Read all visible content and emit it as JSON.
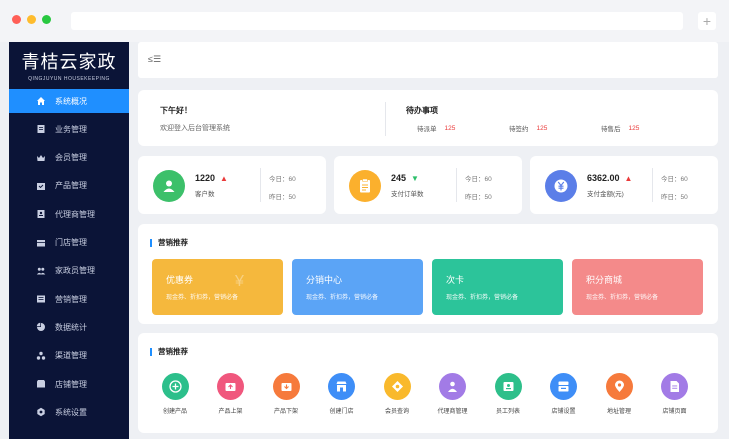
{
  "brand": {
    "name_cn": "青桔云家政",
    "name_en": "QINGJUYUN HOUSEKEEPING"
  },
  "sidebar": {
    "items": [
      {
        "label": "系统概况",
        "icon": "home-icon",
        "active": true
      },
      {
        "label": "业务管理",
        "icon": "document-icon"
      },
      {
        "label": "会员管理",
        "icon": "crown-icon"
      },
      {
        "label": "产品管理",
        "icon": "product-icon"
      },
      {
        "label": "代理商管理",
        "icon": "agent-icon"
      },
      {
        "label": "门店管理",
        "icon": "store-icon"
      },
      {
        "label": "家政员管理",
        "icon": "people-icon"
      },
      {
        "label": "营销管理",
        "icon": "marketing-icon"
      },
      {
        "label": "数据统计",
        "icon": "pie-chart-icon"
      },
      {
        "label": "渠道管理",
        "icon": "channel-icon"
      },
      {
        "label": "店铺管理",
        "icon": "shop-icon"
      },
      {
        "label": "系统设置",
        "icon": "settings-icon"
      }
    ]
  },
  "topbar": {
    "collapse_icon": "≤☰"
  },
  "welcome": {
    "greeting": "下午好！",
    "message": "欢迎登入后台管理系统"
  },
  "todo": {
    "title": "待办事项",
    "items": [
      {
        "label": "待派单",
        "count": "125",
        "icon": "dispatch-icon"
      },
      {
        "label": "待签约",
        "count": "125",
        "icon": "sign-icon"
      },
      {
        "label": "待售后",
        "count": "125",
        "icon": "aftersale-icon"
      }
    ]
  },
  "stats": [
    {
      "value": "1220",
      "trend": "up",
      "trend_glyph": "▲",
      "label": "客户数",
      "today": "今日：60",
      "yesterday": "昨日：50",
      "color": "#3cc06a",
      "icon": "user-icon"
    },
    {
      "value": "245",
      "trend": "down",
      "trend_glyph": "▼",
      "label": "支付订单数",
      "today": "今日：60",
      "yesterday": "昨日：50",
      "color": "#fbb02d",
      "icon": "clipboard-icon"
    },
    {
      "value": "6362.00",
      "trend": "up",
      "trend_glyph": "▲",
      "label": "支付金额(元)",
      "today": "今日：60",
      "yesterday": "昨日：50",
      "color": "#5b7ee8",
      "icon": "yuan-icon"
    }
  ],
  "marketing": {
    "title": "营销推荐",
    "cards": [
      {
        "title": "优惠券",
        "subtitle": "现金券、折扣券，营销必备",
        "color": "#f5b83d",
        "icon": "coupon-icon"
      },
      {
        "title": "分销中心",
        "subtitle": "现金券、折扣券，营销必备",
        "color": "#5ba4f6",
        "icon": "blocks-icon"
      },
      {
        "title": "次卡",
        "subtitle": "现金券、折扣券，营销必备",
        "color": "#2cc49a",
        "icon": "card-icon"
      },
      {
        "title": "积分商城",
        "subtitle": "现金券、折扣券，营销必备",
        "color": "#f48a8a",
        "icon": "points-icon"
      }
    ]
  },
  "tools": {
    "title": "营销推荐",
    "items": [
      {
        "label": "创建产品",
        "color": "#2cbf8b",
        "icon": "plus-icon"
      },
      {
        "label": "产品上架",
        "color": "#f0577d",
        "icon": "upload-icon"
      },
      {
        "label": "产品下架",
        "color": "#f67a3c",
        "icon": "download-icon"
      },
      {
        "label": "创建门店",
        "color": "#3e8ef7",
        "icon": "store-icon"
      },
      {
        "label": "会员查询",
        "color": "#f9b92c",
        "icon": "search-icon"
      },
      {
        "label": "代理商管理",
        "color": "#a27be6",
        "icon": "agent-icon"
      },
      {
        "label": "员工列表",
        "color": "#2dbf8a",
        "icon": "staff-icon"
      },
      {
        "label": "店铺设置",
        "color": "#3e8ef7",
        "icon": "shop-settings-icon"
      },
      {
        "label": "地址管理",
        "color": "#f67a3c",
        "icon": "location-icon"
      },
      {
        "label": "店铺页面",
        "color": "#a27be6",
        "icon": "page-icon"
      }
    ]
  }
}
